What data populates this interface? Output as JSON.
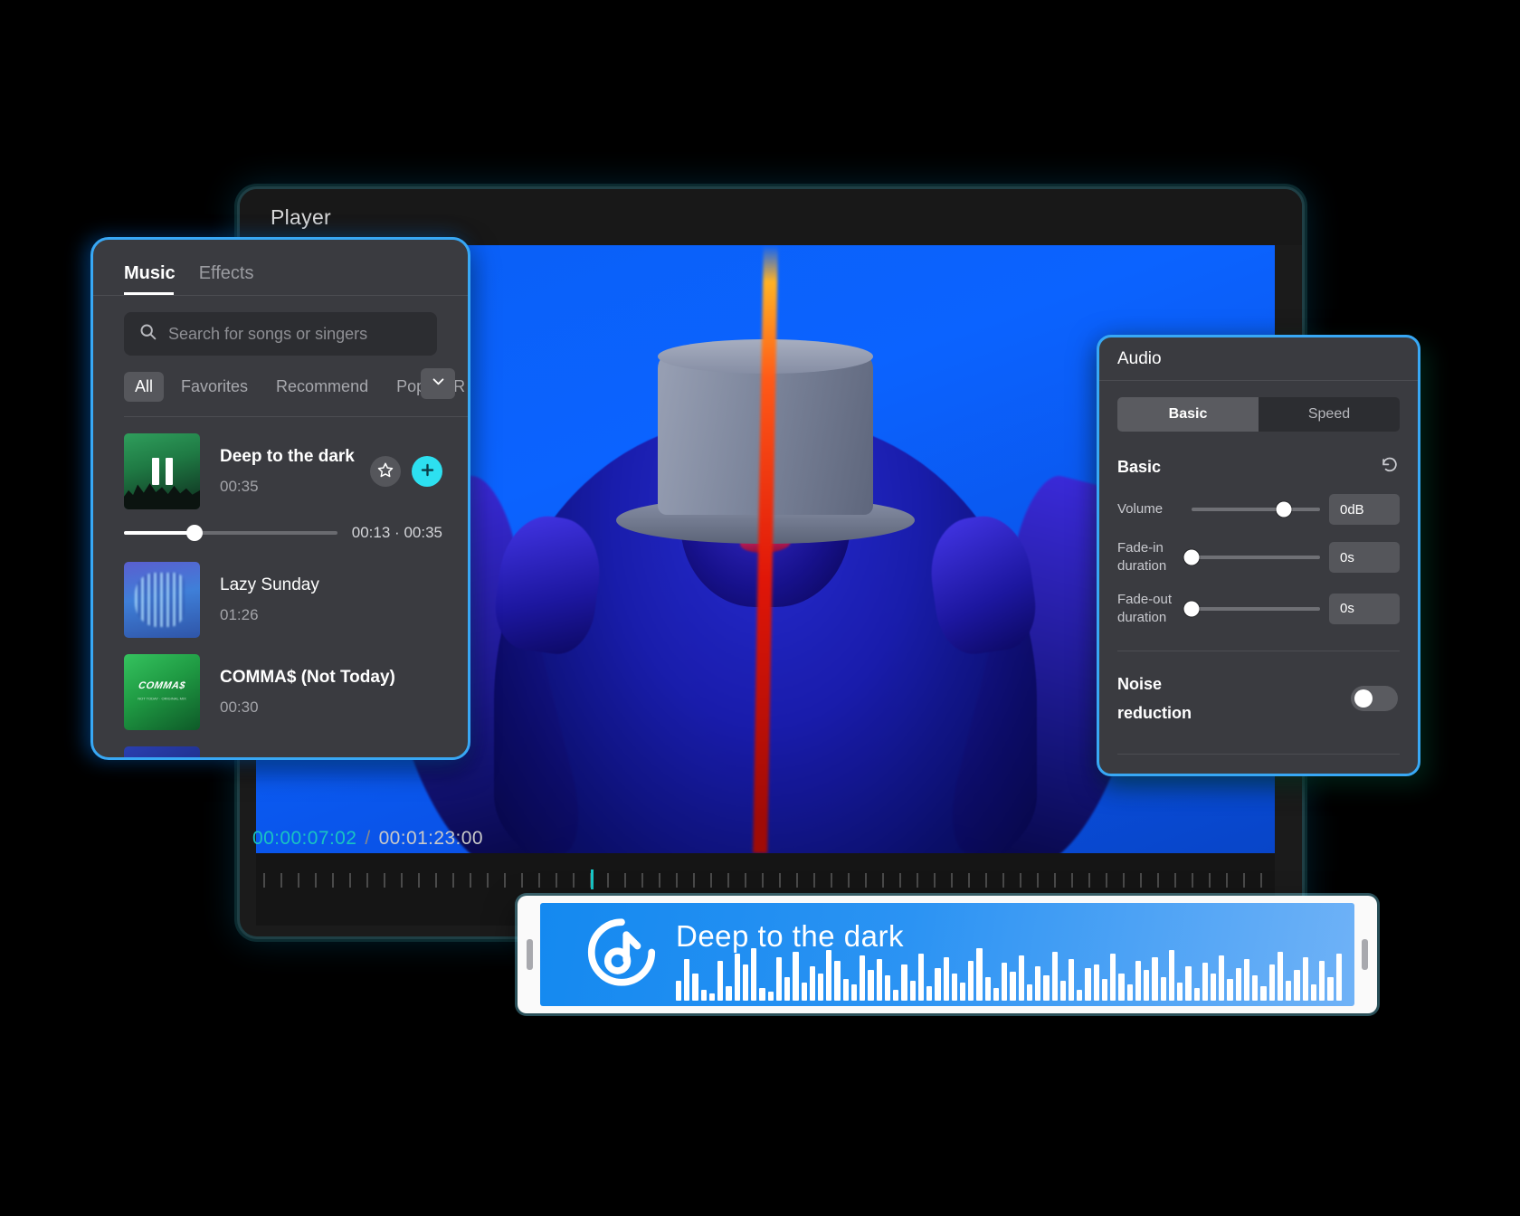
{
  "player": {
    "title": "Player",
    "timeline": {
      "current_time": "00:00:07:02",
      "separator": "/",
      "total_time": "00:01:23:00"
    }
  },
  "music_panel": {
    "tabs": [
      {
        "label": "Music",
        "active": true
      },
      {
        "label": "Effects",
        "active": false
      }
    ],
    "search": {
      "placeholder": "Search for songs or singers",
      "value": "",
      "icon": "search-icon"
    },
    "filters": [
      {
        "label": "All",
        "active": true
      },
      {
        "label": "Favorites",
        "active": false
      },
      {
        "label": "Recommend",
        "active": false
      },
      {
        "label": "Pop",
        "active": false
      },
      {
        "label": "R",
        "active": false
      }
    ],
    "dropdown_icon": "chevron-down-icon",
    "songs": [
      {
        "title": "Deep to the dark",
        "duration": "00:35",
        "playing": true,
        "progress_elapsed": "00:13",
        "progress_separator": "·",
        "progress_total": "00:35",
        "progress_percent": 33,
        "favorite_icon": "star-icon",
        "add_icon": "plus-icon"
      },
      {
        "title": "Lazy Sunday",
        "duration": "01:26",
        "playing": false
      },
      {
        "title": "COMMA$ (Not Today)",
        "duration": "00:30",
        "playing": false,
        "art_text": "COMMA$",
        "art_subtext": "NOT TODAY · ORIGINAL MIX"
      },
      {
        "title": "",
        "duration": "",
        "playing": false
      }
    ]
  },
  "audio_panel": {
    "title": "Audio",
    "segments": [
      {
        "label": "Basic",
        "active": true
      },
      {
        "label": "Speed",
        "active": false
      }
    ],
    "section_label": "Basic",
    "reset_icon": "reset-icon",
    "controls": [
      {
        "label": "Volume",
        "value": "0dB",
        "percent": 72
      },
      {
        "label": "Fade-in duration",
        "value": "0s",
        "percent": 0
      },
      {
        "label": "Fade-out duration",
        "value": "0s",
        "percent": 0
      }
    ],
    "noise_reduction": {
      "label": "Noise reduction",
      "enabled": false
    }
  },
  "clip_bar": {
    "name": "Deep to the dark",
    "icon": "music-note-circle-icon"
  },
  "colors": {
    "accent_cyan": "#2de0f0",
    "accent_blue": "#38a8f5",
    "timeline_teal": "#19c4c2",
    "clip_blue": "#1489f0",
    "panel_bg": "#3a3b40"
  }
}
